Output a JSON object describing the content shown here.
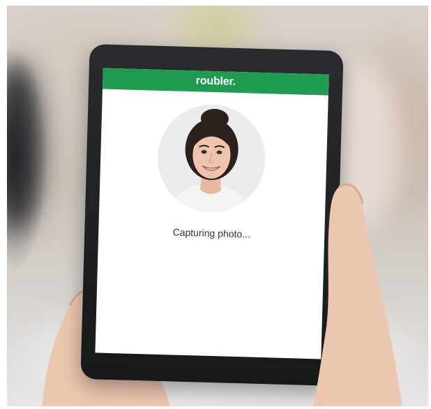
{
  "app": {
    "brand": "roubler.",
    "status": "Capturing photo...",
    "accent_color": "#1f9b52"
  },
  "icons": {
    "profile": "user-photo-icon"
  }
}
